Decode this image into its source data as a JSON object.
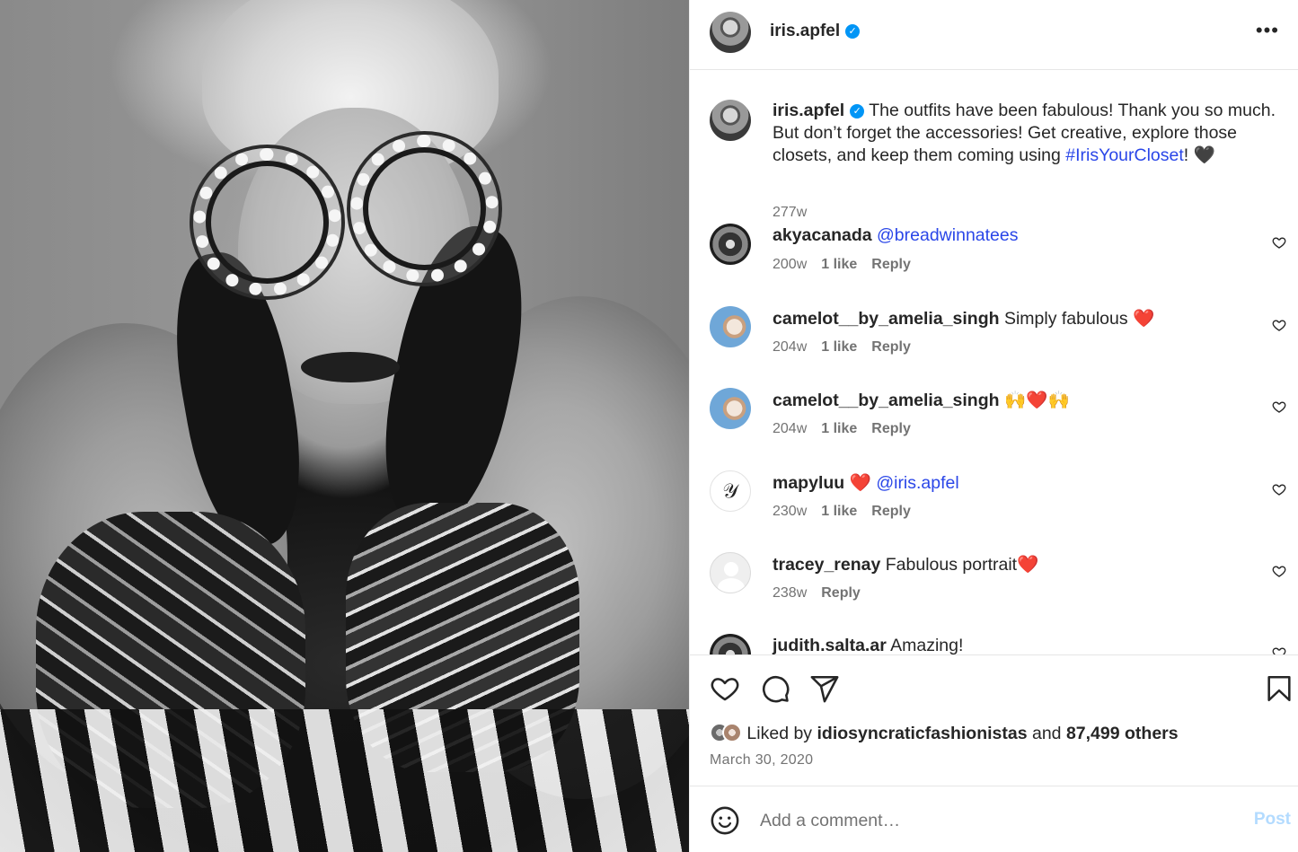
{
  "post": {
    "photo_alt": "",
    "author": "iris.apfel"
  },
  "header": {
    "username": "iris.apfel",
    "verified_mark": "✓",
    "more_label": "•••"
  },
  "caption": {
    "username": "iris.apfel",
    "text_before": " The outfits have been fabulous! Thank you so much. But don’t forget the accessories! Get creative, explore those closets, and keep them coming using ",
    "hashtag": "#IrisYourCloset",
    "text_after": "! 🖤",
    "time": "277w"
  },
  "comments": [
    {
      "username": "akyacanada",
      "text": "",
      "mention": "@breadwinnatees",
      "time": "200w",
      "likes": "1 like",
      "reply": "Reply"
    },
    {
      "username": "camelot__by_amelia_singh",
      "text": " Simply fabulous ❤️",
      "mention": "",
      "time": "204w",
      "likes": "1 like",
      "reply": "Reply"
    },
    {
      "username": "camelot__by_amelia_singh",
      "text": " 🙌❤️🙌",
      "mention": "",
      "time": "204w",
      "likes": "1 like",
      "reply": "Reply"
    },
    {
      "username": "mapyluu",
      "text": " ❤️ ",
      "mention": "@iris.apfel",
      "time": "230w",
      "likes": "1 like",
      "reply": "Reply"
    },
    {
      "username": "tracey_renay",
      "text": " Fabulous portrait❤️",
      "mention": "",
      "time": "238w",
      "likes": "",
      "reply": "Reply"
    },
    {
      "username": "judith.salta.ar",
      "text": " Amazing!",
      "mention": "",
      "time": "",
      "likes": "",
      "reply": ""
    }
  ],
  "icons": {
    "like": "heart-icon",
    "comment": "comment-icon",
    "share": "send-icon",
    "save": "bookmark-icon",
    "emoji": "emoji-icon",
    "more": "more-icon"
  },
  "likes": {
    "prefix": "Liked by ",
    "user": "idiosyncraticfashionistas",
    "middle": " and ",
    "count": "87,499 others"
  },
  "date": "March 30, 2020",
  "add_comment": {
    "placeholder": "Add a comment…",
    "post_label": "Post"
  },
  "colors": {
    "link": "#2a46e8",
    "verified": "#0095f6",
    "post_disabled": "#b3dbff",
    "secondary_text": "#737373"
  }
}
